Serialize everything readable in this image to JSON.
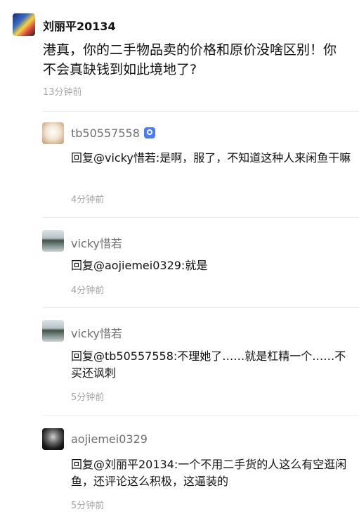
{
  "comment": {
    "author": "刘丽平20134",
    "text": "港真，你的二手物品卖的价格和原价没啥区别！你不会真缺钱到如此境地了?",
    "time": "13分钟前"
  },
  "replies": [
    {
      "author": "tb50557558",
      "badge_icon": "verified-badge-icon",
      "text": "回复@vicky惜若:是啊，服了，不知道这种人来闲鱼干嘛",
      "time": "4分钟前"
    },
    {
      "author": "vicky惜若",
      "text": "回复@aojiemei0329:就是",
      "time": "4分钟前"
    },
    {
      "author": "vicky惜若",
      "text": "回复@tb50557558:不理她了……就是杠精一个……不买还讽刺",
      "time": "5分钟前"
    },
    {
      "author": "aojiemei0329",
      "text": "回复@刘丽平20134:一个不用二手货的人这么有空逛闲鱼，还评论这么积极，这逼装的",
      "time": "5分钟前"
    }
  ]
}
